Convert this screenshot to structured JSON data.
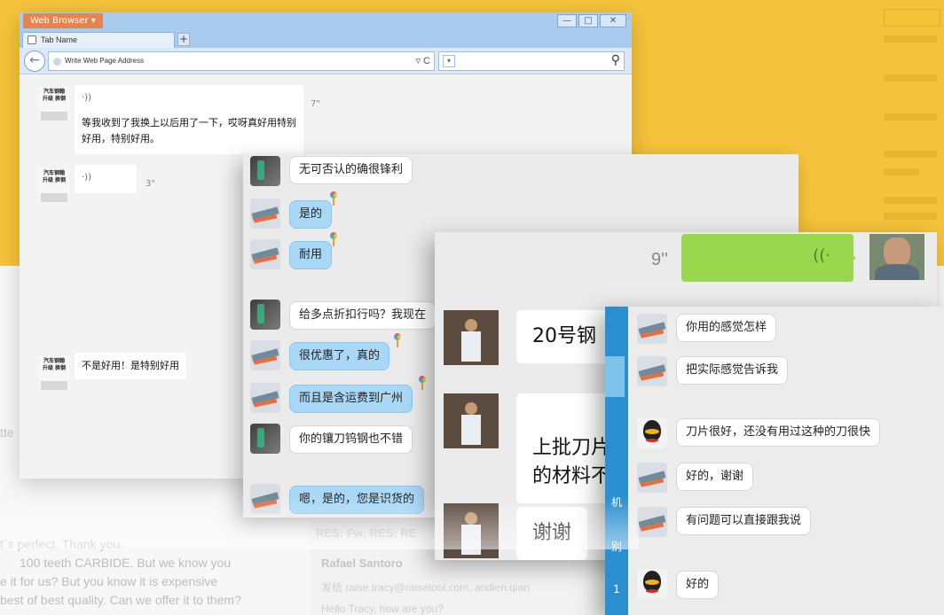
{
  "background": {
    "left_fragment": "tte",
    "email_lines": [
      "t`s perfect. Thank you.",
      "100 teeth CARBIDE. But we know you",
      "e it for us? But you know it is expensive",
      "best of best quality. Can we offer it to them?"
    ],
    "res_title": "RES: Fw: RES: RE",
    "res_from": "Rafael Santoro",
    "res_addr": "发给 raise.tracy@raisetool.com, andien.qian",
    "res_hello": "Hello Tracy, how are you?",
    "colors": {
      "yellow": "#f5c33b",
      "white": "#f7f7f7"
    }
  },
  "browser": {
    "title": "Web Browser",
    "title_arrow": "▾",
    "tab_name": "Tab Name",
    "new_tab": "+",
    "back": "←",
    "address_placeholder": "Write Web Page Address",
    "address_tools": "▿ C",
    "search_dropdown": "▾",
    "search_icon": "⚲",
    "ctrl_min": "—",
    "ctrl_max": "□",
    "ctrl_close": "✕"
  },
  "wechat1": {
    "avatar_text": "汽车钢翰\n升级 换钢",
    "messages": [
      {
        "voice": "·))",
        "text": "等我收到了我换上以后用了一下，哎呀真好用特别好用，特别好用。",
        "duration": "7\""
      },
      {
        "voice": "·))",
        "duration": "3\""
      },
      {
        "text": "不是好用！是特别好用"
      }
    ]
  },
  "qq_chat_mid": {
    "messages": [
      {
        "avatar": "phone",
        "style": "white",
        "text": "无可否认的确很锋利"
      },
      {
        "avatar": "blade",
        "style": "blue",
        "text": "是的",
        "deco": true
      },
      {
        "avatar": "blade",
        "style": "blue",
        "text": "耐用",
        "deco": true
      },
      {
        "avatar": "phone",
        "style": "white",
        "text": "给多点折扣行吗？我现在"
      },
      {
        "avatar": "blade",
        "style": "blue",
        "text": "很优惠了，真的",
        "deco": true
      },
      {
        "avatar": "blade",
        "style": "blue",
        "text": "而且是含运费到广州",
        "deco": true
      },
      {
        "avatar": "phone",
        "style": "white",
        "text": "你的镶刀钨钢也不错"
      },
      {
        "avatar": "blade",
        "style": "blue",
        "text": "嗯，是的，您是识货的",
        "deco": true
      }
    ]
  },
  "wechat_large": {
    "voice_duration": "9''",
    "voice_wave": "((·",
    "messages": [
      {
        "text": "20号钢"
      },
      {
        "text": "上批刀片\n的材料不"
      },
      {
        "text": "谢谢"
      }
    ]
  },
  "qq_chat_front": {
    "strip_labels": [
      "机",
      "别",
      "1"
    ],
    "messages": [
      {
        "avatar": "blade",
        "text": "你用的感觉怎样"
      },
      {
        "avatar": "blade",
        "text": "把实际感觉告诉我"
      },
      {
        "avatar": "qq",
        "text": "刀片很好，还没有用过这种的刀很快"
      },
      {
        "avatar": "blade",
        "text": "好的，谢谢"
      },
      {
        "avatar": "blade",
        "text": "有问题可以直接跟我说"
      },
      {
        "avatar": "qq",
        "text": "好的"
      }
    ]
  }
}
